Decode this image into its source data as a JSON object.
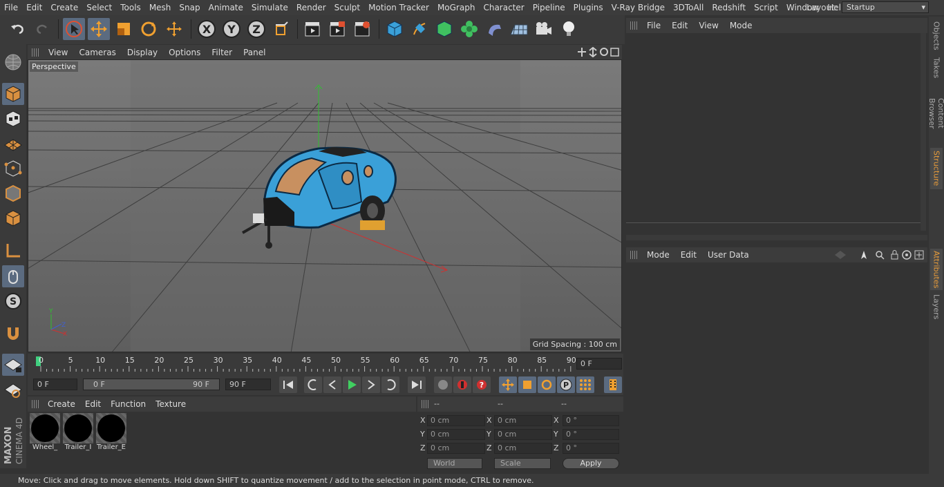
{
  "menubar": {
    "items": [
      "File",
      "Edit",
      "Create",
      "Select",
      "Tools",
      "Mesh",
      "Snap",
      "Animate",
      "Simulate",
      "Render",
      "Sculpt",
      "Motion Tracker",
      "MoGraph",
      "Character",
      "Pipeline",
      "Plugins",
      "V-Ray Bridge",
      "3DToAll",
      "Redshift",
      "Script",
      "Window",
      "Help"
    ],
    "layout_label": "Layout:",
    "layout_value": "Startup"
  },
  "viewport": {
    "menu": [
      "View",
      "Cameras",
      "Display",
      "Options",
      "Filter",
      "Panel"
    ],
    "camera": "Perspective",
    "grid_spacing": "Grid Spacing : 100 cm"
  },
  "timeline": {
    "ticks": [
      "0",
      "5",
      "10",
      "15",
      "20",
      "25",
      "30",
      "35",
      "40",
      "45",
      "50",
      "55",
      "60",
      "65",
      "70",
      "75",
      "80",
      "85",
      "90"
    ],
    "current_frame": "0 F"
  },
  "playbar": {
    "start": "0 F",
    "range_start": "0 F",
    "range_end": "90 F",
    "end": "90 F"
  },
  "materials": {
    "menu": [
      "Create",
      "Edit",
      "Function",
      "Texture"
    ],
    "items": [
      "Wheel_",
      "Trailer_I",
      "Trailer_E"
    ]
  },
  "coords": {
    "headers": [
      "--",
      "--",
      "--"
    ],
    "rows": [
      {
        "axis": "X",
        "pos": "0 cm",
        "size": "0 cm",
        "rot": "0 °"
      },
      {
        "axis": "Y",
        "pos": "0 cm",
        "size": "0 cm",
        "rot": "0 °"
      },
      {
        "axis": "Z",
        "pos": "0 cm",
        "size": "0 cm",
        "rot": "0 °"
      }
    ],
    "mode": "World",
    "type": "Scale",
    "apply": "Apply"
  },
  "objects": {
    "menu": [
      "File",
      "Edit",
      "View",
      "Mode"
    ]
  },
  "attributes": {
    "menu": [
      "Mode",
      "Edit",
      "User Data"
    ]
  },
  "right_tabs": [
    "Objects",
    "Takes",
    "Content Browser",
    "Structure",
    "Attributes",
    "Layers"
  ],
  "status": "Move: Click and drag to move elements. Hold down SHIFT to quantize movement / add to the selection in point mode, CTRL to remove.",
  "colors": {
    "trailer": "#3aa0d8",
    "accent": "#5b6b80",
    "x_axis": "#d04040",
    "y_axis": "#40c040"
  }
}
